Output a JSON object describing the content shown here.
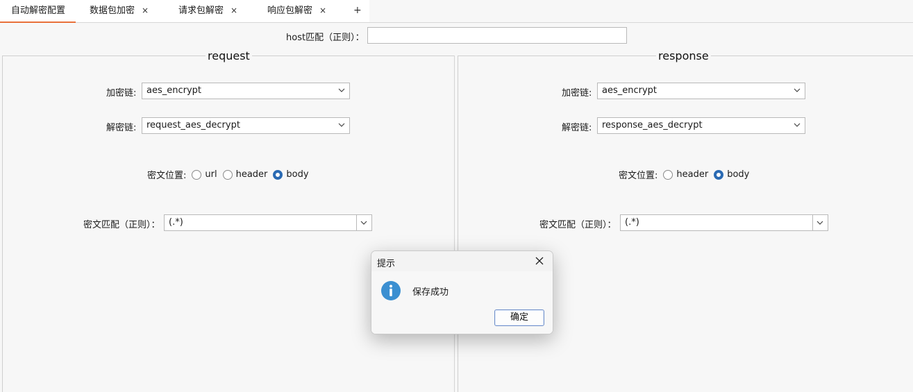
{
  "tabs": [
    {
      "label": "自动解密配置",
      "closable": false,
      "active": true
    },
    {
      "label": "数据包加密",
      "closable": true,
      "active": false
    },
    {
      "label": "请求包解密",
      "closable": true,
      "active": false
    },
    {
      "label": "响应包解密",
      "closable": true,
      "active": false
    }
  ],
  "tab_close_glyph": "×",
  "tab_add_glyph": "+",
  "host": {
    "label": "host匹配（正则）：",
    "value": ""
  },
  "request": {
    "title": "request",
    "encrypt_label": "加密链:",
    "encrypt_value": "aes_encrypt",
    "decrypt_label": "解密链:",
    "decrypt_value": "request_aes_decrypt",
    "position_label": "密文位置:",
    "position_options": [
      "url",
      "header",
      "body"
    ],
    "position_selected": "body",
    "match_label": "密文匹配（正则）：",
    "match_value": "(.*)"
  },
  "response": {
    "title": "response",
    "encrypt_label": "加密链:",
    "encrypt_value": "aes_encrypt",
    "decrypt_label": "解密链:",
    "decrypt_value": "response_aes_decrypt",
    "position_label": "密文位置:",
    "position_options": [
      "header",
      "body"
    ],
    "position_selected": "body",
    "match_label": "密文匹配（正则）：",
    "match_value": "(.*)"
  },
  "dialog": {
    "title": "提示",
    "message": "保存成功",
    "ok_label": "确定",
    "icon": "info-icon"
  },
  "colors": {
    "active_tab_underline": "#e8703a",
    "radio_selected": "#2a6ab3",
    "info_icon": "#3b8fd1"
  }
}
